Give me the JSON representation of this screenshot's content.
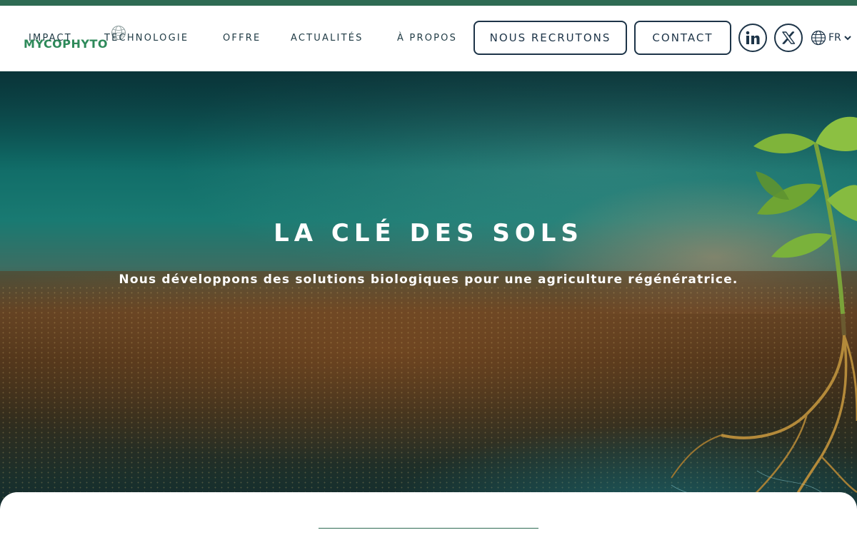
{
  "brand": {
    "logo_text": "MYCOPHYTO",
    "logo_icon": "mycophyto-sphere-icon",
    "accent_color": "#2e6b53",
    "dark_color": "#1d3448"
  },
  "nav": {
    "items": [
      {
        "label": "IMPACT"
      },
      {
        "label": "TECHNOLOGIE"
      },
      {
        "label": "OFFRE"
      },
      {
        "label": "ACTUALITÉS"
      },
      {
        "label": "À PROPOS"
      }
    ],
    "recruit_label": "NOUS RECRUTONS",
    "contact_label": "CONTACT",
    "social": [
      {
        "icon": "linkedin-icon"
      },
      {
        "icon": "x-twitter-icon"
      }
    ],
    "language": {
      "icon": "globe-icon",
      "label": "FR",
      "dropdown_icon": "chevron-down-icon"
    }
  },
  "hero": {
    "title": "LA CLÉ DES SOLS",
    "subtitle": "Nous développons des solutions biologiques pour une agriculture régénératrice."
  }
}
